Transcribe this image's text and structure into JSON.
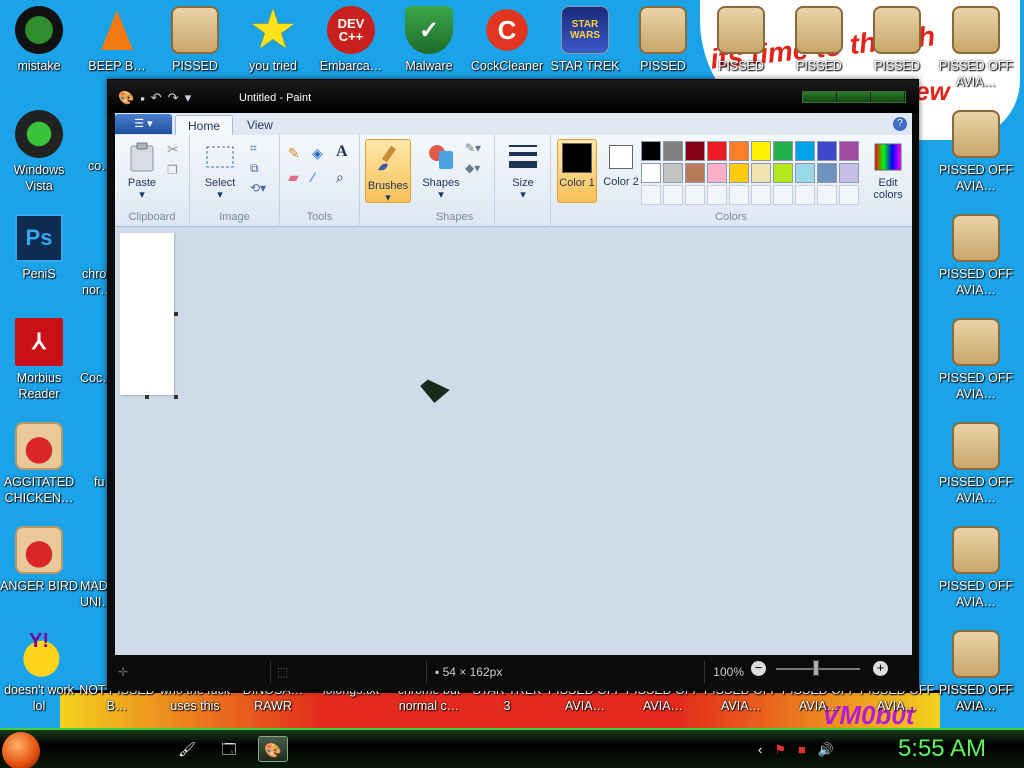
{
  "desktop": {
    "top_row": [
      {
        "label": "mistake",
        "icon": "xbox-logo-icon"
      },
      {
        "label": "BEEP B…",
        "icon": "vlc-cone-icon"
      },
      {
        "label": "PISSED",
        "icon": "angry-birds-seasons-icon"
      },
      {
        "label": "you tried",
        "icon": "star-icon"
      },
      {
        "label": "Embarca…",
        "icon": "dev-cpp-icon"
      },
      {
        "label": "Malware",
        "icon": "shield-check-icon"
      },
      {
        "label": "CockCleaner",
        "icon": "ccleaner-icon"
      },
      {
        "label": "STAR TREK",
        "icon": "star-wars-icon"
      },
      {
        "label": "PISSED",
        "icon": "angry-birds-seasons-icon"
      },
      {
        "label": "PISSED",
        "icon": "angry-birds-seasons-icon"
      },
      {
        "label": "PISSED",
        "icon": "angry-birds-seasons-icon"
      },
      {
        "label": "PISSED",
        "icon": "angry-birds-seasons-icon"
      },
      {
        "label": "PISSED OFF AVIA…",
        "icon": "angry-birds-seasons-icon"
      }
    ],
    "left_column": [
      {
        "label": "Windows Vista",
        "icon": "recycle-bin-icon"
      },
      {
        "label": "PeniS",
        "icon": "photoshop-icon"
      },
      {
        "label": "Morbius Reader",
        "icon": "acrobat-reader-icon"
      },
      {
        "label": "AGGITATED CHICKEN…",
        "icon": "angry-bird-icon"
      },
      {
        "label": "ANGER BIRD",
        "icon": "angry-bird-icon"
      },
      {
        "label": "doesn't work lol",
        "icon": "yahoo-messenger-icon"
      }
    ],
    "partial_column": [
      "co…",
      "chro… nor…",
      "Coc…",
      "fu…",
      "MAD… UNI…",
      "NOT PISSED B…"
    ],
    "right_column_label": "PISSED OFF AVIA…",
    "bottom_row": [
      {
        "label": "who the fuck uses this"
      },
      {
        "label": "DINOSA… RAWR"
      },
      {
        "label": "lolongs.txt"
      },
      {
        "label": "chrome but normal c…"
      },
      {
        "label": "STAR TREK 3"
      },
      {
        "label": "PISSED OFF AVIA…"
      },
      {
        "label": "PISSED OFF AVIA…"
      },
      {
        "label": "PISSED OFF AVIA…"
      },
      {
        "label": "PISSED OFF AVIA…"
      },
      {
        "label": "PISSED OFF AVIA…"
      },
      {
        "label": "PISSED OFF AVIA…"
      }
    ],
    "wallpaper_text": "its time to thrash",
    "wallpaper_text2": "ew",
    "wallpaper_signature": "VM0b0t"
  },
  "paint": {
    "window_title": "Untitled - Paint",
    "tabs": [
      "Home",
      "View"
    ],
    "help": "?",
    "groups": {
      "clipboard": "Clipboard",
      "image": "Image",
      "tools": "Tools",
      "shapes": "Shapes",
      "colors": "Colors"
    },
    "buttons": {
      "paste": "Paste",
      "select": "Select",
      "brushes": "Brushes",
      "shapes": "Shapes",
      "size": "Size",
      "color1": "Color 1",
      "color2": "Color 2",
      "edit_colors": "Edit colors"
    },
    "palette": [
      "#000000",
      "#7f7f7f",
      "#880015",
      "#ed1c24",
      "#ff7f27",
      "#fff200",
      "#22b14c",
      "#00a2e8",
      "#3f48cc",
      "#a349a4",
      "#ffffff",
      "#c3c3c3",
      "#b97a57",
      "#ffaec9",
      "#ffc90e",
      "#efe4b0",
      "#b5e61d",
      "#99d9ea",
      "#7092be",
      "#c8bfe7"
    ],
    "color1": "#000000",
    "color2": "#ffffff",
    "status": {
      "image_size": "54 × 162px",
      "zoom": "100%"
    }
  },
  "taskbar": {
    "time": "5:55 AM"
  }
}
